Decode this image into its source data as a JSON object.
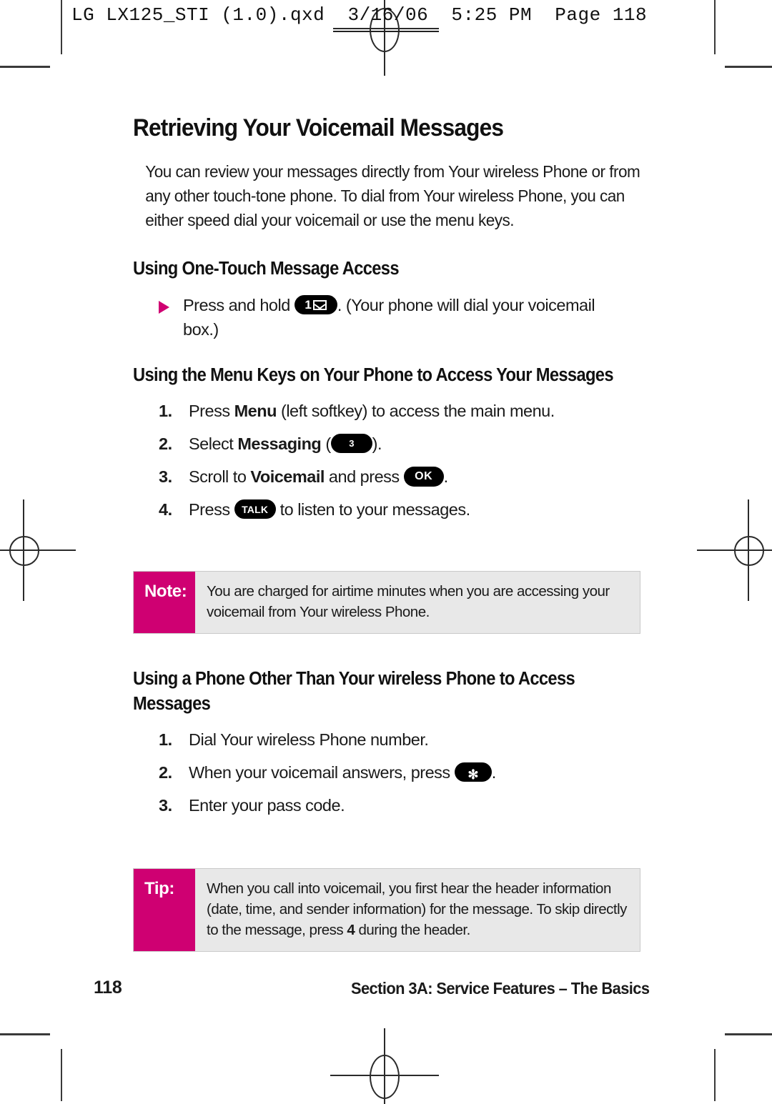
{
  "print_header": {
    "text": "LG LX125_STI (1.0).qxd  3/16/06  5:25 PM  Page 118"
  },
  "document": {
    "title": "Retrieving Your Voicemail Messages",
    "intro": "You can review your messages directly from Your wireless Phone or from any other touch-tone phone. To dial from Your wireless Phone, you can either speed dial your voicemail or use the menu keys.",
    "sections": [
      {
        "heading": "Using One-Touch Message Access",
        "bullet": {
          "before_key": "Press and hold",
          "key": "1-envelope-key",
          "after_key": ". (Your phone will dial your voicemail box.)"
        }
      },
      {
        "heading": "Using the Menu Keys on Your Phone to Access Your Messages",
        "steps": [
          {
            "num": "1.",
            "pre": "Press ",
            "bold": "Menu",
            "post": " (left softkey) to access the main menu."
          },
          {
            "num": "2.",
            "pre": "Select ",
            "bold": "Messaging",
            "post": " (",
            "key": "3",
            "tail": ")."
          },
          {
            "num": "3.",
            "pre": "Scroll to ",
            "bold": "Voicemail",
            "post": " and press ",
            "key": "OK",
            "tail": "."
          },
          {
            "num": "4.",
            "pre": "Press ",
            "key": "TALK",
            "tail": " to listen to your messages."
          }
        ]
      },
      {
        "heading": "Using a Phone Other Than Your wireless Phone to Access Messages",
        "steps": [
          {
            "num": "1.",
            "pre": "Dial Your wireless Phone number."
          },
          {
            "num": "2.",
            "pre": "When your voicemail answers, press ",
            "key": "*",
            "tail": "."
          },
          {
            "num": "3.",
            "pre": "Enter your pass code."
          }
        ]
      }
    ],
    "note_box": {
      "label": "Note:",
      "text": "You are charged for airtime minutes when you are accessing your voicemail from Your wireless Phone."
    },
    "tip_box": {
      "label": "Tip:",
      "text_part1": "When you call into voicemail, you first hear the header information (date, time, and sender information) for the message. To skip directly to the message, press ",
      "text_bold": "4",
      "text_part2": " during the header."
    },
    "footer": {
      "page_number": "118",
      "section_label": "Section 3A: Service Features – The Basics"
    },
    "keys": {
      "one_mail_digit": "1",
      "three": "3",
      "ok": "OK",
      "talk": "TALK",
      "star": "✻"
    }
  },
  "colors": {
    "accent_magenta": "#cf0072",
    "callout_background": "#e8e8e8",
    "key_background": "#000000",
    "text": "#1a1a1a"
  }
}
